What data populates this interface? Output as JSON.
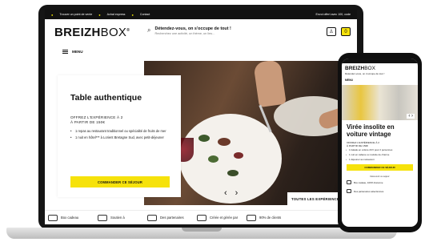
{
  "colors": {
    "accent": "#f6e20b",
    "dark": "#111111"
  },
  "topbar": {
    "items": [
      "Trouver un point de vente",
      "Achat express",
      "Contact"
    ],
    "right": "Envoi offert avec 100, code"
  },
  "brand": {
    "logo_bold": "BREIZH",
    "logo_light": "BOX",
    "reg": "®"
  },
  "search": {
    "headline": "Détendez-vous, on s'occupe de tout !",
    "sub": "Recherchez une activité, un thème, un lieu...",
    "icon": "search-icon"
  },
  "header_icons": [
    "user-icon",
    "cart-icon"
  ],
  "cart_count": "0",
  "menu_label": "MENU",
  "hero": {
    "card_title": "Table authentique",
    "offer_line1": "OFFREZ L'EXPÉRIENCE À 2",
    "offer_line2": "À PARTIR DE 150€",
    "bullets": [
      "1 repas au restaurant traditionnel ou spécialité de fruits de mer",
      "1 nuit en hôtel*** à Lorient Bretagne Sud, avec petit-déjeuner"
    ],
    "cta": "COMMANDER CE SÉJOUR",
    "corner_link": "TOUTES LES EXPÉRIENCES",
    "prev": "‹",
    "next": "›"
  },
  "categories": [
    "Box cadeau",
    "Soutien à",
    "Des partenaires",
    "Créée et gérée par",
    "90% de clients"
  ],
  "phone": {
    "logo_bold": "BREIZH",
    "logo_light": "BOX",
    "search": "Détendez-vous, on s'occupe de tout !",
    "menu": "MENU",
    "title": "Virée insolite en voiture vintage",
    "offer_line1": "OFFREZ L'EXPÉRIENCE À 2",
    "offer_line2": "À PARTIR DE 150€",
    "bullets": [
      "1 balade en voiture 2CV pour 2 personnes",
      "1 nuit en cabane ou roulotte de charme",
      "1 déjeuner au restaurant"
    ],
    "cta": "COMMANDER CE SÉJOUR",
    "link": "Découvrir ce séjour",
    "cats": [
      "Box cadeau, 100% bretonne",
      "Des partenaires sélectionnés"
    ]
  }
}
